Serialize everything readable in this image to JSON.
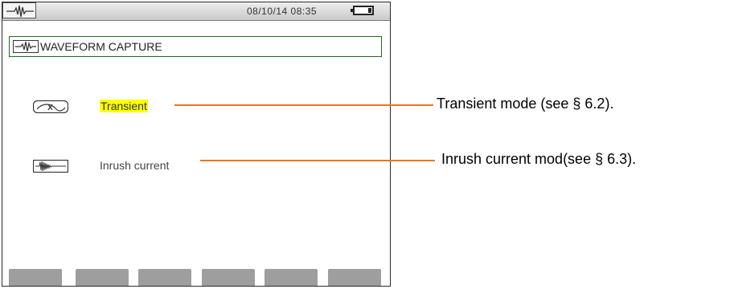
{
  "status_bar": {
    "datetime": "08/10/14 08:35",
    "mode_icon": "waveform-icon",
    "battery_icon": "battery-icon"
  },
  "title": {
    "icon": "waveform-icon",
    "text": "WAVEFORM CAPTURE"
  },
  "menu": {
    "items": [
      {
        "icon": "transient-icon",
        "label": "Transient",
        "selected": true,
        "highlight_color": "#ffff00"
      },
      {
        "icon": "inrush-icon",
        "label": "Inrush current",
        "selected": false
      }
    ]
  },
  "function_keys": {
    "count": 6,
    "color": "#9e9e9e"
  },
  "callouts": [
    {
      "text": "Transient mode (see § 6.2).",
      "color": "#e87722"
    },
    {
      "text": "Inrush current mod(see § 6.3).",
      "color": "#e87722"
    }
  ],
  "colors": {
    "title_border": "#1e6b24",
    "highlight": "#ffff00",
    "callout_line": "#e87722"
  }
}
